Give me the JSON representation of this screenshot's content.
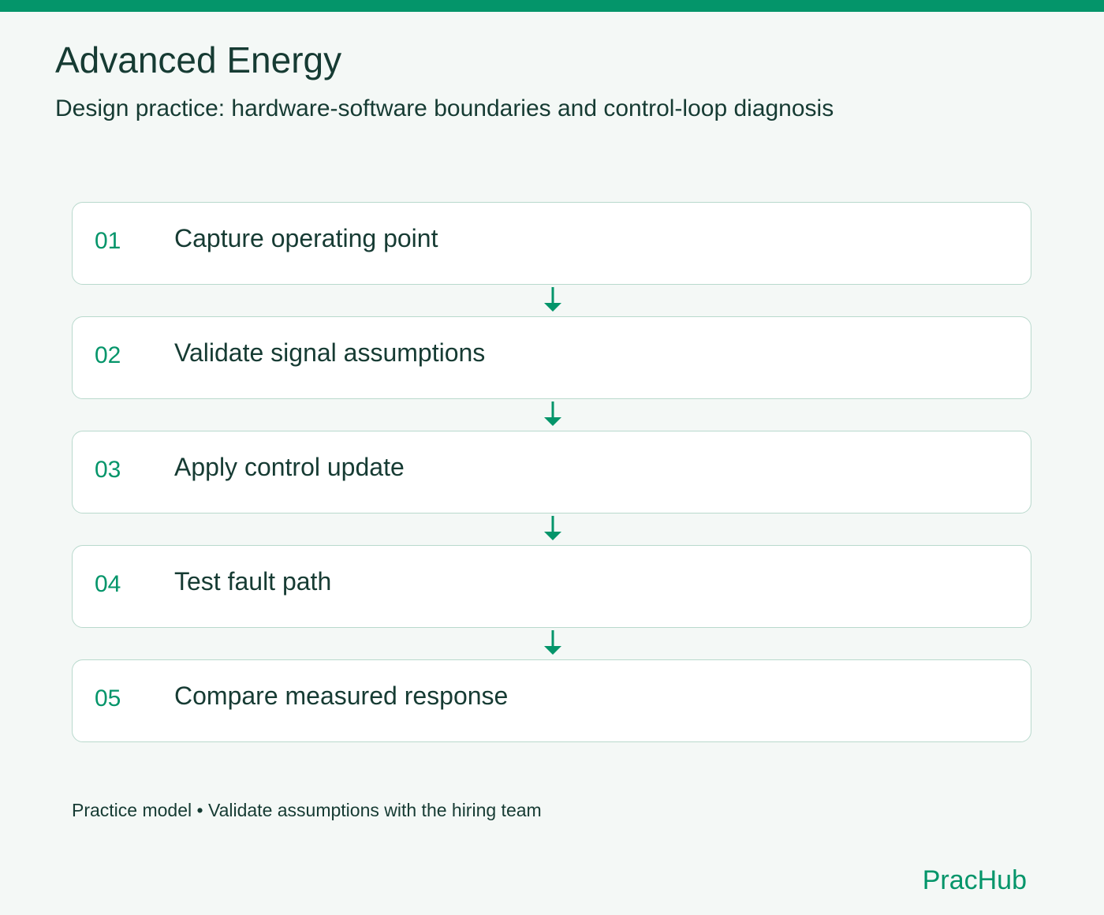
{
  "header": {
    "title": "Advanced Energy",
    "subtitle": "Design practice: hardware-software boundaries and control-loop diagnosis"
  },
  "steps": [
    {
      "number": "01",
      "label": "Capture operating point"
    },
    {
      "number": "02",
      "label": "Validate signal assumptions"
    },
    {
      "number": "03",
      "label": "Apply control update"
    },
    {
      "number": "04",
      "label": "Test fault path"
    },
    {
      "number": "05",
      "label": "Compare measured response"
    }
  ],
  "connector_icon": "arrow-down-icon",
  "footer": {
    "note": "Practice model • Validate assumptions with the hiring team",
    "brand": "PracHub"
  },
  "colors": {
    "accent": "#04956a",
    "text": "#163b33",
    "background": "#f4f8f6",
    "card_border": "#b9d9cd",
    "card_background": "#ffffff"
  }
}
